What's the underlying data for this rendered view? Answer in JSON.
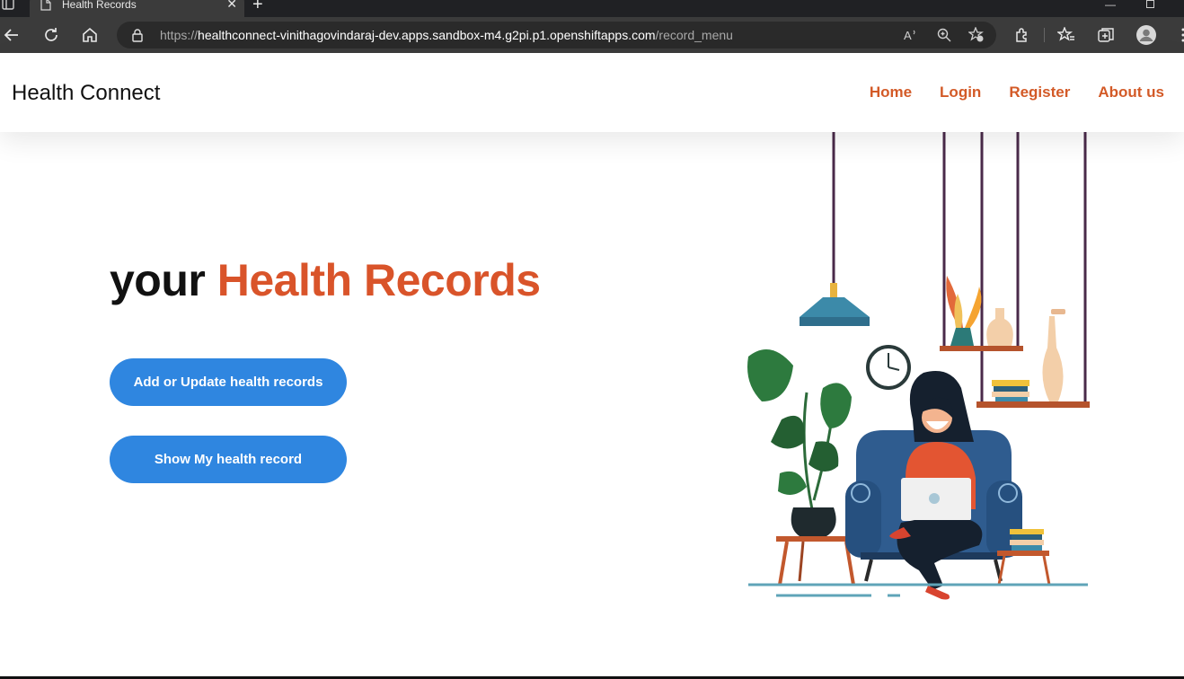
{
  "browser": {
    "tab_title": "Health Records",
    "tab_close": "✕",
    "new_tab": "+",
    "url_scheme": "https://",
    "url_host": "healthconnect-vinithagovindaraj-dev.apps.sandbox-m4.g2pi.p1.openshiftapps.com",
    "url_path": "/record_menu"
  },
  "header": {
    "brand": "Health Connect",
    "nav": [
      "Home",
      "Login",
      "Register",
      "About us"
    ]
  },
  "hero": {
    "title_dark": "your",
    "title_accent": "Health Records",
    "buttons": [
      "Add or Update health records",
      "Show My health record"
    ]
  },
  "colors": {
    "accent": "#d9542a",
    "button": "#2f86e0",
    "nav": "#d35a27"
  },
  "icons": [
    "sidebar-icon",
    "page-icon",
    "back-icon",
    "reload-icon",
    "home-icon",
    "lock-icon",
    "read-aloud-icon",
    "zoom-icon",
    "add-favorite-icon",
    "extensions-icon",
    "favorites-icon",
    "collections-icon",
    "profile-icon",
    "more-icon"
  ]
}
